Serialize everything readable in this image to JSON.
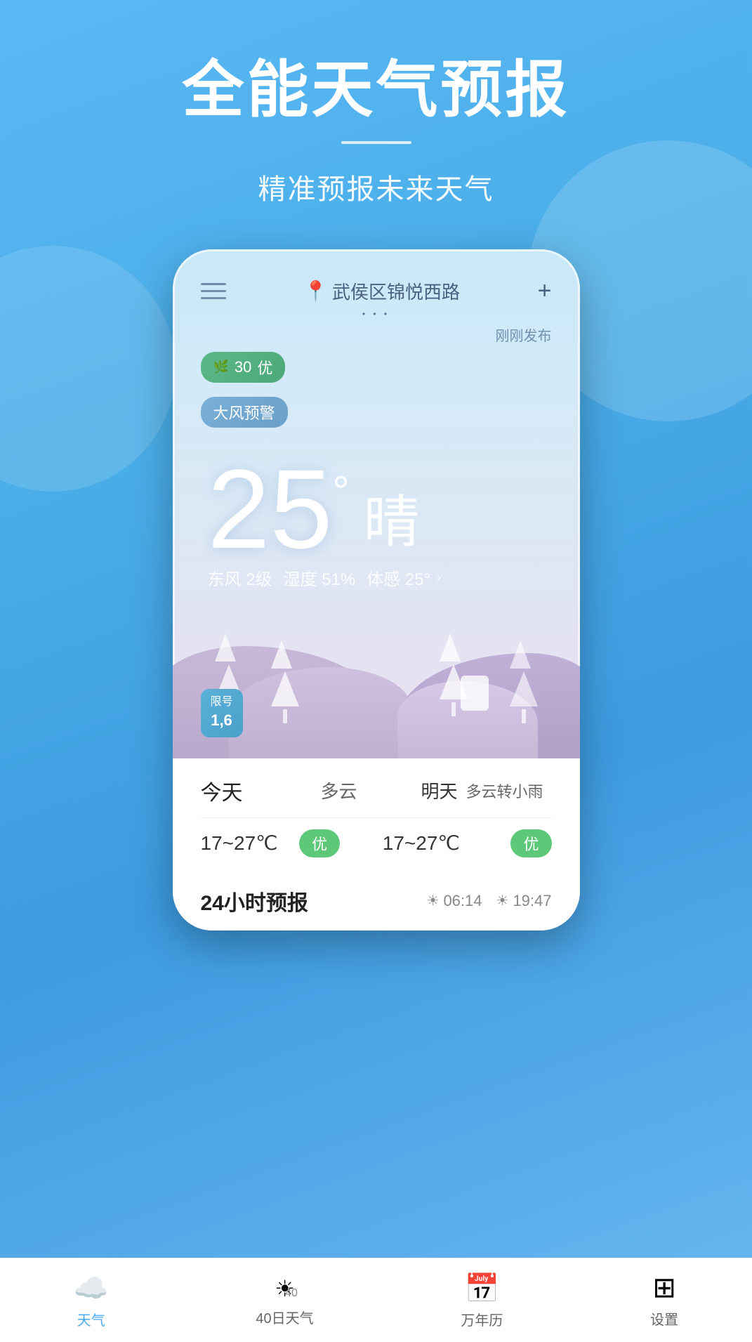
{
  "hero": {
    "title": "全能天气预报",
    "divider": true,
    "subtitle": "精准预报未来天气"
  },
  "phone": {
    "location": "武侯区锦悦西路",
    "status": "刚刚发布",
    "aqi": {
      "value": "30",
      "label": "优"
    },
    "warning": "大风预警",
    "temperature": "25",
    "degree": "°",
    "condition": "晴",
    "details": {
      "wind": "东风 2级",
      "humidity": "湿度 51%",
      "feel": "体感 25°"
    },
    "plate": {
      "label": "限号",
      "numbers": "1,6"
    },
    "forecast": [
      {
        "day": "今天",
        "weather": "多云",
        "temp": "17~27℃",
        "quality": "优"
      },
      {
        "day": "明天",
        "weather": "多云转小雨",
        "temp": "17~27℃",
        "quality": "优"
      }
    ],
    "hourly_section": {
      "title": "24小时预报",
      "sunrise": "06:14",
      "sunset": "19:47"
    }
  },
  "bottom_nav": {
    "items": [
      {
        "icon": "☁️",
        "label": "天气",
        "active": true
      },
      {
        "icon": "☀️",
        "label": "40日天气",
        "active": false
      },
      {
        "icon": "📅",
        "label": "万年历",
        "active": false
      },
      {
        "icon": "⊞",
        "label": "设置",
        "active": false
      }
    ]
  }
}
